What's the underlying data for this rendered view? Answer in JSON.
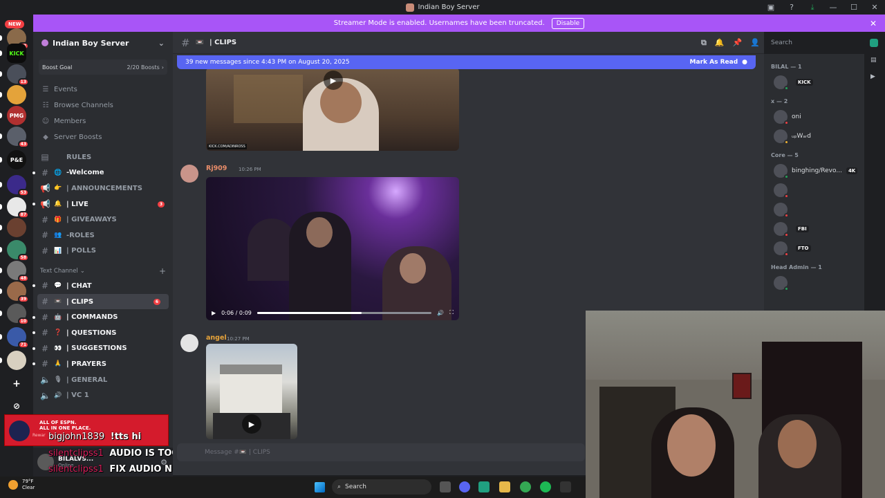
{
  "window": {
    "title": "Indian Boy Server"
  },
  "servers": {
    "new_label": "NEW",
    "items": [
      {
        "label": "",
        "badge": "52",
        "color": "#8a6a4a"
      },
      {
        "label": "KICK",
        "badge": "",
        "color": "#0c0c0c",
        "text_color": "#53fc18"
      },
      {
        "label": "",
        "badge": "13",
        "color": "#4a4f5a"
      },
      {
        "label": "",
        "badge": "",
        "color": "#e4a33a"
      },
      {
        "label": "PMG",
        "badge": "",
        "color": "#b03030"
      },
      {
        "label": "",
        "badge": "43",
        "color": "#5a5f6a"
      },
      {
        "label": "P&E",
        "badge": "",
        "color": "#111111"
      },
      {
        "label": "",
        "badge": "53",
        "color": "#3b2a8a"
      },
      {
        "label": "",
        "badge": "87",
        "color": "#e8e8e8"
      },
      {
        "label": "",
        "badge": "",
        "color": "#6a4030"
      },
      {
        "label": "",
        "badge": "58",
        "color": "#3a8a6a"
      },
      {
        "label": "",
        "badge": "48",
        "color": "#7a7a7a"
      },
      {
        "label": "",
        "badge": "39",
        "color": "#9a6a4a"
      },
      {
        "label": "",
        "badge": "10",
        "color": "#5a5a5a"
      },
      {
        "label": "",
        "badge": "71",
        "color": "#3a5aa8"
      },
      {
        "label": "",
        "badge": "",
        "color": "#d8d0c0"
      }
    ]
  },
  "streamer_bar": {
    "message": "Streamer Mode is enabled. Usernames have been truncated.",
    "button": "Disable"
  },
  "guild": {
    "name": "Indian Boy Server"
  },
  "boost": {
    "label": "Boost Goal",
    "count": "2/20 Boosts"
  },
  "nav": [
    {
      "icon": "calendar-icon",
      "glyph": "☰",
      "label": "Events"
    },
    {
      "icon": "browse-icon",
      "glyph": "☷",
      "label": "Browse Channels"
    },
    {
      "icon": "members-icon",
      "glyph": "☺",
      "label": "Members"
    },
    {
      "icon": "boost-icon",
      "glyph": "◆",
      "label": "Server Boosts"
    }
  ],
  "channels_top": [
    {
      "type": "rules",
      "emoji": "",
      "name": "RULES",
      "unread": false,
      "mention": ""
    },
    {
      "type": "text",
      "emoji": "🌐",
      "name": "-Welcome",
      "unread": true,
      "mention": ""
    },
    {
      "type": "announce",
      "emoji": "👉",
      "name": "| ANNOUNCEMENTS",
      "unread": false,
      "mention": ""
    },
    {
      "type": "announce",
      "emoji": "🔔",
      "name": "| LIVE",
      "unread": true,
      "mention": "3"
    },
    {
      "type": "text",
      "emoji": "🎁",
      "name": "| GIVEAWAYS",
      "unread": false,
      "mention": ""
    },
    {
      "type": "text",
      "emoji": "👥",
      "name": "-ROLES",
      "unread": false,
      "mention": ""
    },
    {
      "type": "text",
      "emoji": "📊",
      "name": "| POLLS",
      "unread": false,
      "mention": ""
    }
  ],
  "category": {
    "name": "Text Channel"
  },
  "channels_text": [
    {
      "type": "text",
      "emoji": "💬",
      "name": "| CHAT",
      "unread": true,
      "mention": ""
    },
    {
      "type": "text",
      "emoji": "📼",
      "name": "| CLIPS",
      "unread": true,
      "mention": "6",
      "selected": true
    },
    {
      "type": "text",
      "emoji": "🤖",
      "name": "| COMMANDS",
      "unread": true,
      "mention": ""
    },
    {
      "type": "text",
      "emoji": "❓",
      "name": "| QUESTIONS",
      "unread": true,
      "mention": ""
    },
    {
      "type": "text",
      "emoji": "👀",
      "name": "| SUGGESTIONS",
      "unread": true,
      "mention": ""
    },
    {
      "type": "text",
      "emoji": "🙏",
      "name": "| PRAYERS",
      "unread": true,
      "mention": ""
    },
    {
      "type": "voice",
      "emoji": "🎙",
      "name": "| GENERAL",
      "unread": false,
      "mention": ""
    },
    {
      "type": "voice",
      "emoji": "🔊",
      "name": "| VC 1",
      "unread": false,
      "mention": ""
    }
  ],
  "ad": {
    "line1": "ALL OF ESPN.",
    "line2": "ALL IN ONE PLACE.",
    "reward": "Rewar"
  },
  "user": {
    "name": "BILALVS...",
    "status": "Online"
  },
  "chat_overlay": [
    {
      "user": "bigjohn1839",
      "text": "!tts hi"
    },
    {
      "user": "silentclipss1",
      "text": "AUDIO IS TOOO LOW"
    },
    {
      "user": "silentclipss1",
      "text": "FIX AUDIO NIGGA"
    }
  ],
  "channel_header": {
    "emoji": "📼",
    "name": "| CLIPS"
  },
  "search": {
    "placeholder": "Search"
  },
  "new_messages": {
    "text": "39 new messages since 4:43 PM on August 20, 2025",
    "action": "Mark As Read"
  },
  "messages": [
    {
      "author": "",
      "time": "",
      "watermark": "KICK.COM/ADINROSS"
    },
    {
      "author": "Rj909",
      "time": "10:26 PM",
      "author_color": "#e98d6a",
      "video_time": "0:06 / 0:09",
      "progress": 0.6
    },
    {
      "author": "angel",
      "time": "10:27 PM",
      "author_color": "#e8a43a"
    }
  ],
  "message_input": {
    "placeholder": "Message #📼 | CLIPS"
  },
  "members": {
    "groups": [
      {
        "name": "BILAL — 1",
        "members": [
          {
            "name": "",
            "tag": "KICK",
            "status": "#23a55a"
          }
        ]
      },
      {
        "name": "x — 2",
        "members": [
          {
            "name": "oni",
            "tag": "",
            "status": "#f23f43"
          },
          {
            "name": "ᵤₚWₐᵣd",
            "tag": "",
            "status": "#f0b232"
          }
        ]
      },
      {
        "name": "Core — 5",
        "members": [
          {
            "name": "binghing/Revo...",
            "tag": "4K",
            "status": "#23a55a"
          },
          {
            "name": "",
            "tag": "",
            "status": "#f23f43"
          },
          {
            "name": "",
            "tag": "",
            "status": "#f23f43"
          },
          {
            "name": "",
            "tag": "FBI",
            "status": "#f23f43"
          },
          {
            "name": "",
            "tag": "FTO",
            "status": "#f23f43"
          }
        ]
      },
      {
        "name": "Head Admin — 1",
        "members": [
          {
            "name": "",
            "tag": "",
            "status": "#23a55a"
          }
        ]
      }
    ]
  },
  "weather": {
    "temp": "79°F",
    "cond": "Clear"
  },
  "taskbar": {
    "search": "Search"
  },
  "colors": {
    "accent": "#5865f2",
    "streamer": "#a855f7",
    "mention": "#f23f43"
  }
}
